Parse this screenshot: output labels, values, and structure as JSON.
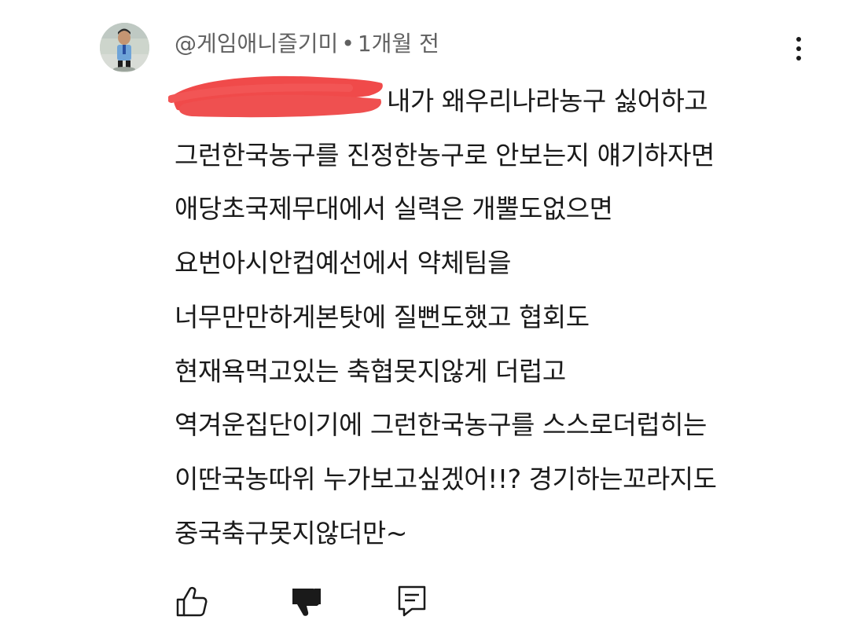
{
  "comment": {
    "author": "@게임애니즐기미",
    "separator": "•",
    "time": "1개월 전",
    "lines": [
      "내가 왜우리나라농구 싫어하고",
      "그런한국농구를 진정한농구로 안보는지 얘기하자면",
      "애당초국제무대에서 실력은 개뿔도없으면",
      "요번아시안컵예선에서 약체팀을",
      "너무만만하게본탓에 질뻔도했고 협회도",
      "현재욕먹고있는 축협못지않게 더럽고",
      "역겨운집단이기에 그런한국농구를 스스로더럽히는",
      "이딴국농따위 누가보고싶겠어!!? 경기하는꼬라지도",
      "중국축구못지않더만~"
    ]
  },
  "icons": {
    "avatar": "avatar-figure",
    "more": "more-vertical-icon",
    "like": "thumbs-up-outline-icon",
    "dislike": "thumbs-down-filled-icon",
    "reply": "reply-comment-icon"
  },
  "colors": {
    "meta_text": "#606060",
    "body_text": "#1a1a1a",
    "redaction": "#f04a4a"
  }
}
